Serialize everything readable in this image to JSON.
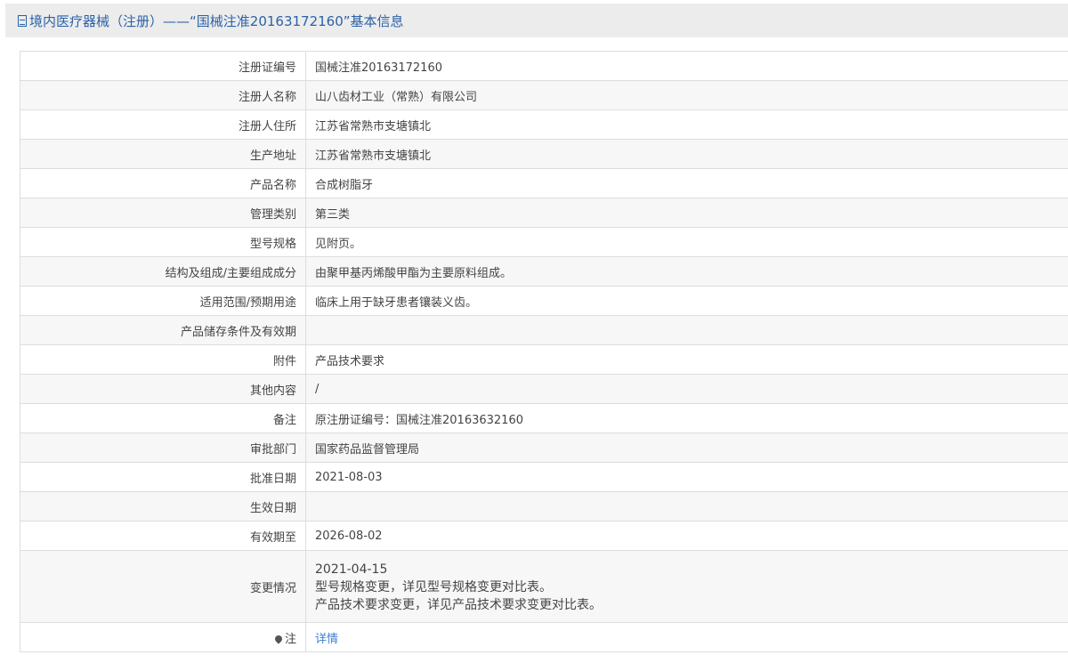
{
  "header": {
    "title": "境内医疗器械（注册）——“国械注准20163172160”基本信息",
    "icon": "document-icon"
  },
  "rows": [
    {
      "label": "注册证编号",
      "value": "国械注准20163172160"
    },
    {
      "label": "注册人名称",
      "value": "山八齿材工业（常熟）有限公司"
    },
    {
      "label": "注册人住所",
      "value": "江苏省常熟市支塘镇北"
    },
    {
      "label": "生产地址",
      "value": "江苏省常熟市支塘镇北"
    },
    {
      "label": "产品名称",
      "value": "合成树脂牙"
    },
    {
      "label": "管理类别",
      "value": "第三类"
    },
    {
      "label": "型号规格",
      "value": "见附页。"
    },
    {
      "label": "结构及组成/主要组成成分",
      "value": "由聚甲基丙烯酸甲酯为主要原料组成。"
    },
    {
      "label": "适用范围/预期用途",
      "value": "临床上用于缺牙患者镶装义齿。"
    },
    {
      "label": "产品储存条件及有效期",
      "value": ""
    },
    {
      "label": "附件",
      "value": "产品技术要求"
    },
    {
      "label": "其他内容",
      "value": "/"
    },
    {
      "label": "备注",
      "value": "原注册证编号：国械注准20163632160"
    },
    {
      "label": "审批部门",
      "value": "国家药品监督管理局"
    },
    {
      "label": "批准日期",
      "value": "2021-08-03"
    },
    {
      "label": "生效日期",
      "value": ""
    },
    {
      "label": "有效期至",
      "value": "2026-08-02"
    }
  ],
  "change": {
    "label": "变更情况",
    "lines": [
      "2021-04-15",
      "型号规格变更，详见型号规格变更对比表。",
      "产品技术要求变更，详见产品技术要求变更对比表。"
    ]
  },
  "note": {
    "label": "注",
    "link": "详情"
  }
}
